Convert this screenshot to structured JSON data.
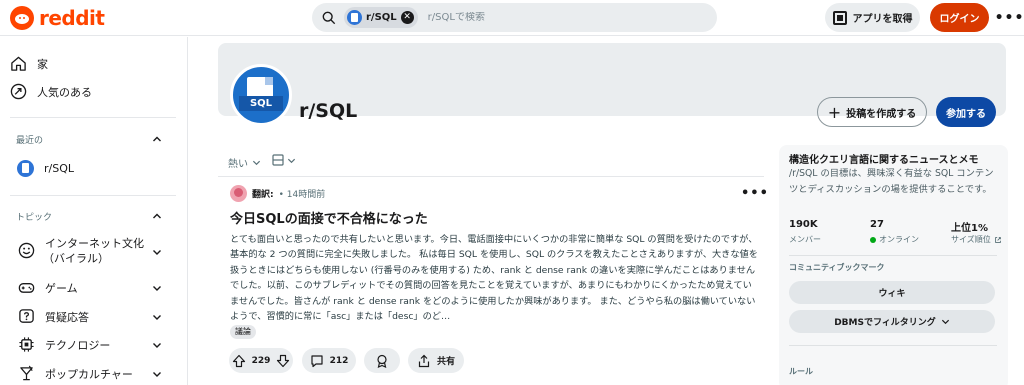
{
  "header": {
    "logo_text": "reddit",
    "search_chip": "r/SQL",
    "search_placeholder": "r/SQLで検索",
    "get_app": "アプリを取得",
    "login": "ログイン",
    "more": "•••"
  },
  "sidebar": {
    "items": [
      {
        "label": "家",
        "icon": "home-icon"
      },
      {
        "label": "人気のある",
        "icon": "popular-icon"
      }
    ],
    "recent_title": "最近の",
    "recent": [
      {
        "label": "r/SQL"
      }
    ],
    "topics_title": "トピック",
    "topics": [
      {
        "label": "インターネット文化",
        "label2": "（バイラル）",
        "icon": "smiley-icon"
      },
      {
        "label": "ゲーム",
        "icon": "gamepad-icon"
      },
      {
        "label": "質疑応答",
        "icon": "question-icon"
      },
      {
        "label": "テクノロジー",
        "icon": "chip-icon"
      },
      {
        "label": "ポップカルチャー",
        "icon": "popculture-icon"
      }
    ]
  },
  "community": {
    "name": "r/SQL",
    "create_post": "投稿を作成する",
    "join": "参加する"
  },
  "feed": {
    "sort_label": "熱い",
    "post": {
      "author": "翻訳:",
      "time": "• 14時間前",
      "title": "今日SQLの面接で不合格になった",
      "body": "とても面白いと思ったので共有したいと思います。今日、電話面接中にいくつかの非常に簡単な SQL の質問を受けたのですが、基本的な 2 つの質問に完全に失敗しました。 私は毎日 SQL を使用し、SQL のクラスを教えたことさえありますが、大きな値を扱うときにはどちらも使用しない (行番号のみを使用する) ため、rank と dense rank の違いを実際に学んだことはありませんでした。以前、このサブレディットでその質問の回答を見たことを覚えていますが、あまりにもわかりにくかったため覚えていませんでした。皆さんが rank と dense rank をどのように使用したか興味があります。 また、どうやら私の脳は働いていないようで、習慣的に常に「asc」または「desc」のど…",
      "flair": "議論",
      "votes": "229",
      "comments": "212",
      "share": "共有",
      "more": "•••"
    }
  },
  "about": {
    "title": "構造化クエリ言語に関するニュースとメモ",
    "description": "/r/SQL の目標は、興味深く有益な SQL コンテンツとディスカッションの場を提供することです。",
    "stats": [
      {
        "value": "190K",
        "label": "メンバー"
      },
      {
        "value": "27",
        "label": "オンライン"
      },
      {
        "value": "上位1%",
        "label": "サイズ順位"
      }
    ],
    "bookmarks_title": "コミュニティブックマーク",
    "bookmarks": [
      "ウィキ",
      "DBMSでフィルタリング"
    ],
    "rules_title": "ルール"
  },
  "colors": {
    "brand": "#ff4500",
    "login": "#d93900",
    "join": "#0d49a5",
    "online_dot": "#01a816"
  }
}
